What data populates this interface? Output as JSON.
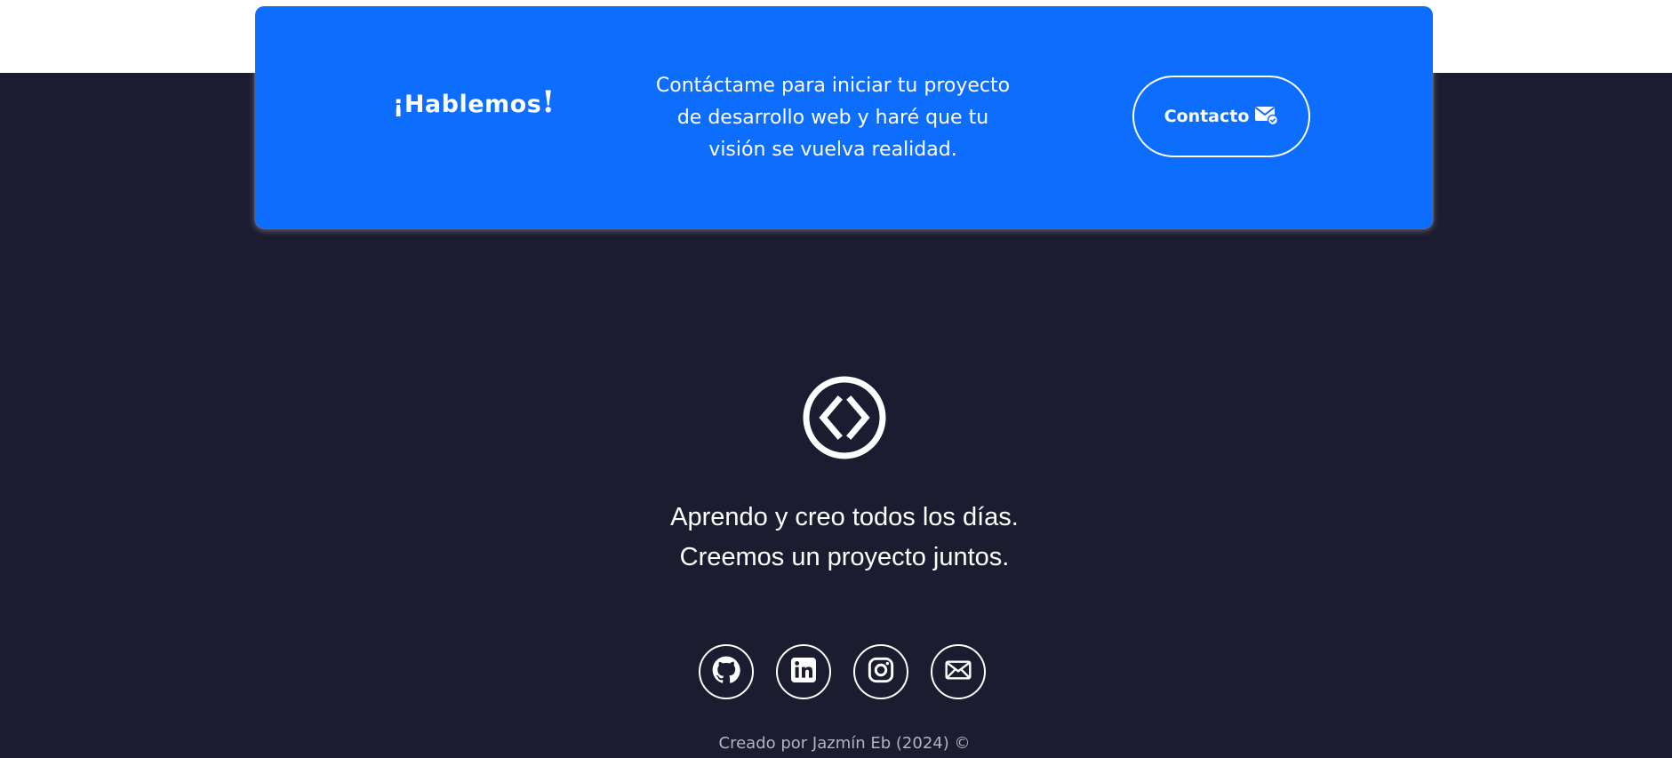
{
  "cta": {
    "title": "¡Hablemos",
    "title_end": "!",
    "text": "Contáctame para iniciar tu proyecto de desarrollo web y haré que tu visión se vuelva realidad.",
    "button_label": "Contacto",
    "button_icon": "envelope-check-icon"
  },
  "footer": {
    "logo_icon": "code-circle-icon",
    "tagline_line1": "Aprendo y creo todos los días.",
    "tagline_line2": "Creemos un proyecto juntos.",
    "social": [
      {
        "icon": "github-icon"
      },
      {
        "icon": "linkedin-icon"
      },
      {
        "icon": "instagram-icon"
      },
      {
        "icon": "mail-icon"
      }
    ],
    "credit": "Creado por Jazmín Eb (2024) ©"
  },
  "colors": {
    "background": "#1c1c31",
    "accent": "#0d6efd",
    "text": "#ffffff",
    "muted": "#b4b4c0"
  }
}
